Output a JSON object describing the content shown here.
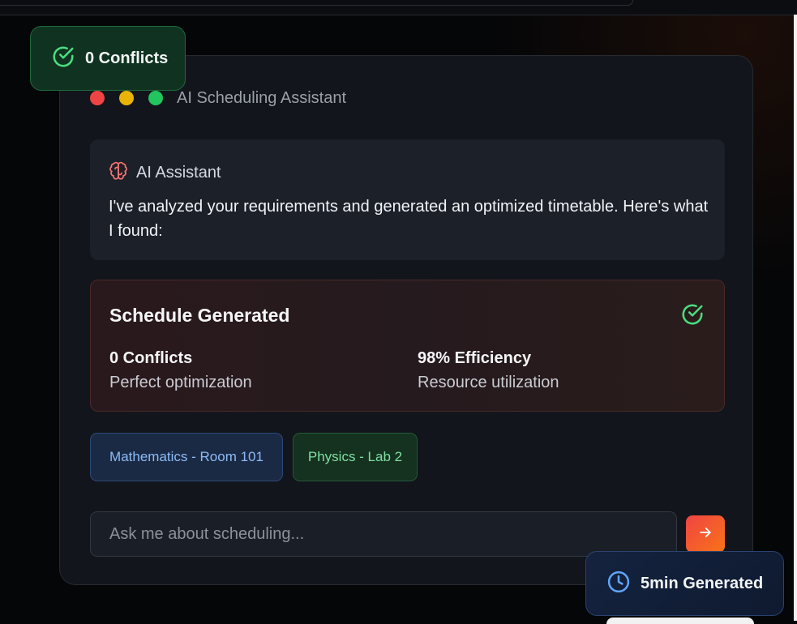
{
  "window": {
    "title": "AI Scheduling Assistant"
  },
  "assistant": {
    "name": "AI Assistant",
    "icon": "brain-icon",
    "message": "I've analyzed your requirements and generated an optimized timetable. Here's what I found:"
  },
  "schedule": {
    "title": "Schedule Generated",
    "stats": [
      {
        "value": "0 Conflicts",
        "caption": "Perfect optimization"
      },
      {
        "value": "98% Efficiency",
        "caption": "Resource utilization"
      }
    ]
  },
  "chips": [
    {
      "label": "Mathematics - Room 101"
    },
    {
      "label": "Physics - Lab 2"
    }
  ],
  "input": {
    "placeholder": "Ask me about scheduling...",
    "value": ""
  },
  "badges": {
    "conflicts": "0 Conflicts",
    "generated": "5min Generated"
  },
  "colors": {
    "success": "#22c55e",
    "danger": "#ef4444",
    "warning": "#eab308",
    "info": "#60a5fa",
    "accent": "#f97316"
  }
}
